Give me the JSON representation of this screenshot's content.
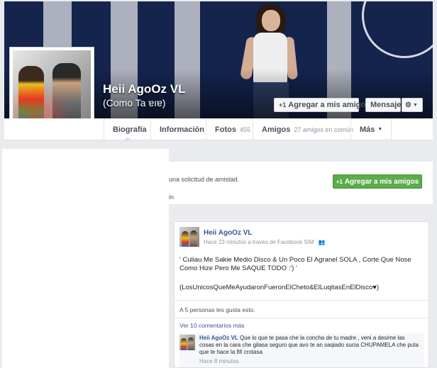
{
  "profile": {
    "name": "Heii AgoOz VL",
    "alternate_name": "(Como Ta ɐıɐ)"
  },
  "cover_actions": {
    "add_friend": "Agregar a mis amigos",
    "message": "Mensaje",
    "settings_icon": "gear-icon",
    "dropdown_icon": "caret-down-icon"
  },
  "tabs": [
    {
      "label": "Biografía"
    },
    {
      "label": "Información"
    },
    {
      "label": "Fotos",
      "count": "455"
    },
    {
      "label": "Amigos",
      "count": "27 amigos en común"
    },
    {
      "label": "Más"
    }
  ],
  "friend_request": {
    "text": "una solicitud de amistad.",
    "text_line2": "in",
    "button": "Agregar a mis amigos"
  },
  "post": {
    "author": "Heii AgoOz VL",
    "meta": "Hace 23 minutos a través de Facebook SIM",
    "body": "' Culiau Me Sakie Medio Disco & Un Poco El Agranel SOLA , Corte Que Nose Como Hize Pero Me SAQUE TODO :') '",
    "hashtags": "(LosUnicosQueMeAyudaronFueronElCheto&ElLuqitasEnElDisco♥)",
    "likes": "A 5 personas les gusta esto.",
    "more_comments": "Ver 10 comentarios más",
    "comment": {
      "author": "Heii AgoOz VL",
      "text": "Que lo que te pasa che la concha de tu madre , veni a desime las cosas en la cara che gilasa seguro que avo te an saqiado sucia CHUPAMELA che puta que te hace la fifi crotasa",
      "time": "Hace 8 minutos"
    }
  },
  "colors": {
    "cover_bg": "#14244d",
    "link_blue": "#365899",
    "green_button": "#5cab4c"
  }
}
